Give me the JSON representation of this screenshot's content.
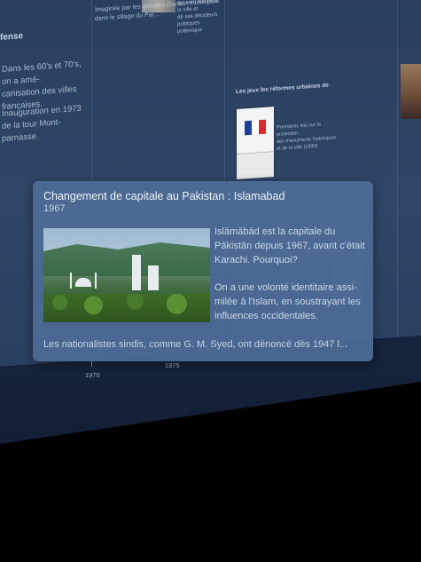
{
  "background": {
    "left_column": {
      "title": "fense",
      "para1": "Dans les 60's et 70's, on a amé-\ncanisation des villes françaises.",
      "para2": "Inauguration en 1973 de la tour Mont-\nparnasse."
    },
    "top_center_text": "Imaginée par les groupes d'action municipale dans le sillage du Par...",
    "top_right_text": "qui sont hostile à la ville et\nde ses décideurs politiques\npolémique",
    "right_column": {
      "title": "Les jeux les réformes urbaines de",
      "text": "Premières lois sur la protection\ndes monuments historiques\net de la ville (1930)"
    },
    "flag_caption": "MINISTÈRE DE LA VILLE",
    "axis_years": [
      "1970",
      "1975"
    ]
  },
  "popup": {
    "title": "Changement de capitale au Pakistan : Islamabad",
    "year": "1967",
    "paragraph1": "Islāmābād est la capitale du Pākistān depuis 1967, avant c'était Karachi. Pourquoi?",
    "paragraph2": "On a une volonté identitaire assi-milée à l'Islam, en soustrayant les influences occidentales.",
    "footer": "Les nationalistes sindis, comme G. M. Syed, ont dénoncé dès 1947 l..."
  }
}
